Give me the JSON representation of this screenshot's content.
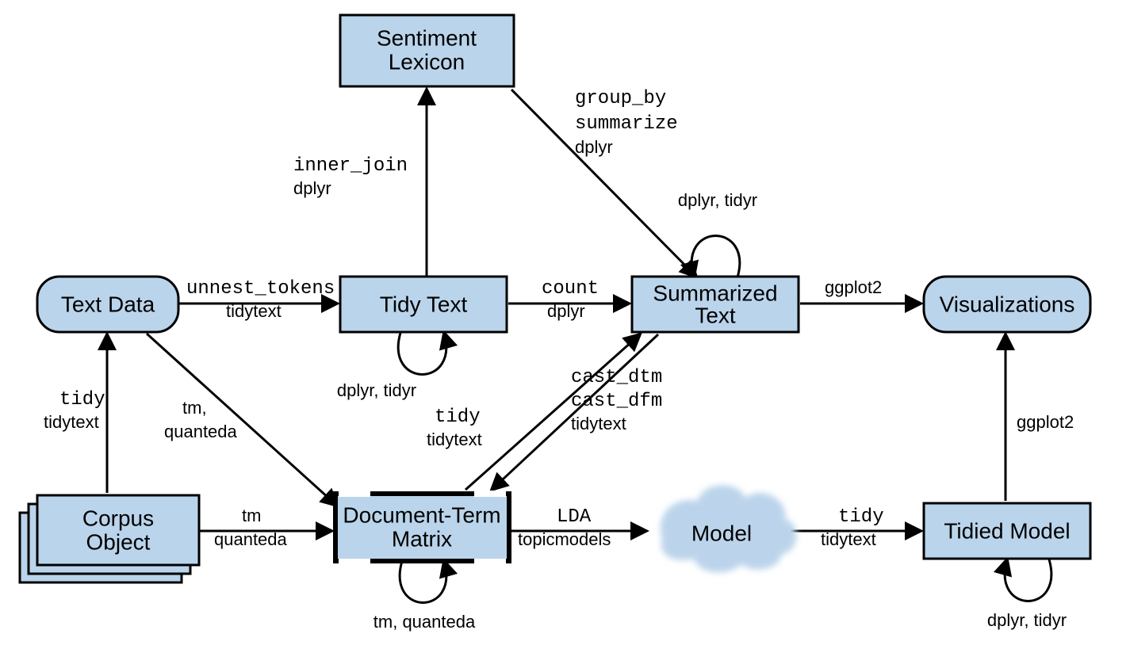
{
  "nodes": {
    "text_data": "Text Data",
    "corpus_object_l1": "Corpus",
    "corpus_object_l2": "Object",
    "sentiment_lexicon_l1": "Sentiment",
    "sentiment_lexicon_l2": "Lexicon",
    "tidy_text": "Tidy Text",
    "dtm_l1": "Document-Term",
    "dtm_l2": "Matrix",
    "summarized_l1": "Summarized",
    "summarized_l2": "Text",
    "model": "Model",
    "tidied_model": "Tidied Model",
    "visualizations": "Visualizations"
  },
  "edges": {
    "corpus_to_text_f": "tidy",
    "corpus_to_text_p": "tidytext",
    "text_to_tidy_f": "unnest_tokens",
    "text_to_tidy_p": "tidytext",
    "tidy_to_sentiment_f": "inner_join",
    "tidy_to_sentiment_p": "dplyr",
    "tidy_self": "dplyr, tidyr",
    "tidy_to_summarized_f": "count",
    "tidy_to_summarized_p": "dplyr",
    "sentiment_to_summarized_f1": "group_by",
    "sentiment_to_summarized_f2": "summarize",
    "sentiment_to_summarized_p": "dplyr",
    "summarized_self": "dplyr, tidyr",
    "summarized_to_viz_p": "ggplot2",
    "text_to_dtm_f": "tm,",
    "text_to_dtm_p": "quanteda",
    "corpus_to_dtm_f": "tm",
    "corpus_to_dtm_p": "quanteda",
    "dtm_to_summarized_f": "tidy",
    "dtm_to_summarized_p": "tidytext",
    "summarized_to_dtm_f1": "cast_dtm",
    "summarized_to_dtm_f2": "cast_dfm",
    "summarized_to_dtm_p": "tidytext",
    "dtm_self": "tm, quanteda",
    "dtm_to_model_f": "LDA",
    "dtm_to_model_p": "topicmodels",
    "model_to_tidied_f": "tidy",
    "model_to_tidied_p": "tidytext",
    "tidied_self": "dplyr, tidyr",
    "tidied_to_viz_p": "ggplot2"
  }
}
